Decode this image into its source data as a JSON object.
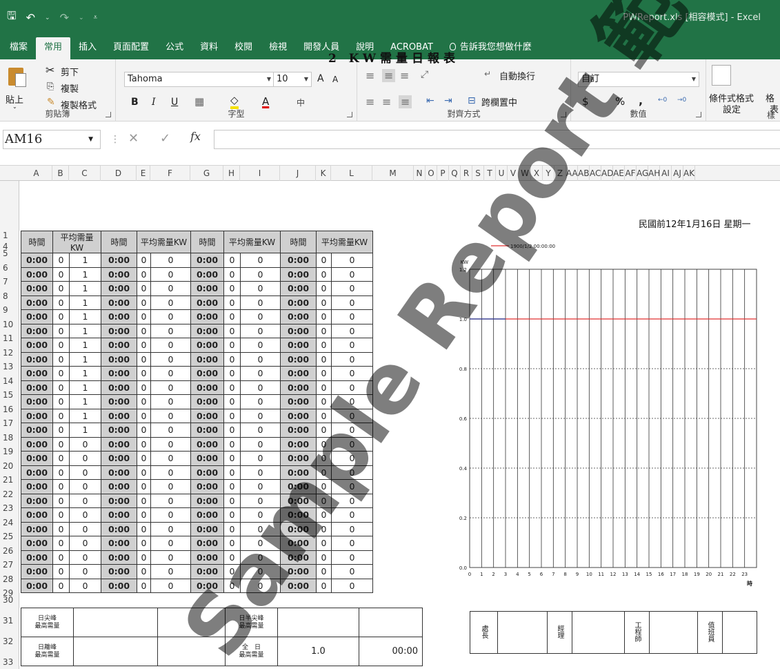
{
  "window": {
    "title": "PWReport.xls  [相容模式]  -  Excel"
  },
  "ribbon": {
    "tabs": [
      "檔案",
      "常用",
      "插入",
      "頁面配置",
      "公式",
      "資料",
      "校閱",
      "檢視",
      "開發人員",
      "說明",
      "ACROBAT"
    ],
    "active_tab": "常用",
    "tell_me": "告訴我您想做什麼",
    "clipboard": {
      "paste": "貼上",
      "cut": "剪下",
      "copy": "複製",
      "format_painter": "複製格式",
      "label": "剪貼簿"
    },
    "font": {
      "name": "Tahoma",
      "size": "10",
      "grow": "A",
      "shrink": "A",
      "bold": "B",
      "italic": "I",
      "underline": "U",
      "color_letter": "A",
      "label": "字型"
    },
    "alignment": {
      "wrap_text": "自動換行",
      "merge_center": "跨欄置中",
      "label": "對齊方式"
    },
    "number": {
      "format": "自訂",
      "currency": "$",
      "percent": "%",
      "comma": ",",
      "label": "數值"
    },
    "styles": {
      "conditional": "條件式格式",
      "conditional_line2": "設定",
      "format_as": "格",
      "format_as_line2": "表",
      "label": "樣"
    }
  },
  "formula_bar": {
    "name_box": "AM16",
    "fx": "fx",
    "cancel": "✕",
    "enter": "✓",
    "value": ""
  },
  "columns": [
    "A",
    "B",
    "C",
    "D",
    "E",
    "F",
    "G",
    "H",
    "I",
    "J",
    "K",
    "L",
    "M",
    "N",
    "O",
    "P",
    "Q",
    "R",
    "S",
    "T",
    "U",
    "V",
    "W",
    "X",
    "Y",
    "Z",
    "AA",
    "AB",
    "AC",
    "AD",
    "AE",
    "AF",
    "AG",
    "AH",
    "AI",
    "AJ",
    "AK"
  ],
  "rows": [
    "1",
    "4",
    "5",
    "6",
    "7",
    "8",
    "9",
    "10",
    "11",
    "12",
    "13",
    "14",
    "15",
    "16",
    "17",
    "18",
    "19",
    "20",
    "21",
    "22",
    "23",
    "24",
    "25",
    "26",
    "27",
    "28",
    "29",
    "30",
    "31",
    "32",
    "33"
  ],
  "report": {
    "title": "2 KW需量日報表",
    "date": "民國前12年1月16日 星期一",
    "headers": [
      "時間",
      "平均需量KW",
      "時間",
      "平均需量KW",
      "時間",
      "平均需量KW",
      "時間",
      "平均需量KW"
    ],
    "rows": [
      [
        "0:00",
        "0",
        "1",
        "0:00",
        "0",
        "0",
        "0:00",
        "0",
        "0",
        "0:00",
        "0",
        "0"
      ],
      [
        "0:00",
        "0",
        "1",
        "0:00",
        "0",
        "0",
        "0:00",
        "0",
        "0",
        "0:00",
        "0",
        "0"
      ],
      [
        "0:00",
        "0",
        "1",
        "0:00",
        "0",
        "0",
        "0:00",
        "0",
        "0",
        "0:00",
        "0",
        "0"
      ],
      [
        "0:00",
        "0",
        "1",
        "0:00",
        "0",
        "0",
        "0:00",
        "0",
        "0",
        "0:00",
        "0",
        "0"
      ],
      [
        "0:00",
        "0",
        "1",
        "0:00",
        "0",
        "0",
        "0:00",
        "0",
        "0",
        "0:00",
        "0",
        "0"
      ],
      [
        "0:00",
        "0",
        "1",
        "0:00",
        "0",
        "0",
        "0:00",
        "0",
        "0",
        "0:00",
        "0",
        "0"
      ],
      [
        "0:00",
        "0",
        "1",
        "0:00",
        "0",
        "0",
        "0:00",
        "0",
        "0",
        "0:00",
        "0",
        "0"
      ],
      [
        "0:00",
        "0",
        "1",
        "0:00",
        "0",
        "0",
        "0:00",
        "0",
        "0",
        "0:00",
        "0",
        "0"
      ],
      [
        "0:00",
        "0",
        "1",
        "0:00",
        "0",
        "0",
        "0:00",
        "0",
        "0",
        "0:00",
        "0",
        "0"
      ],
      [
        "0:00",
        "0",
        "1",
        "0:00",
        "0",
        "0",
        "0:00",
        "0",
        "0",
        "0:00",
        "0",
        "0"
      ],
      [
        "0:00",
        "0",
        "1",
        "0:00",
        "0",
        "0",
        "0:00",
        "0",
        "0",
        "0:00",
        "0",
        "0"
      ],
      [
        "0:00",
        "0",
        "1",
        "0:00",
        "0",
        "0",
        "0:00",
        "0",
        "0",
        "0:00",
        "0",
        "0"
      ],
      [
        "0:00",
        "0",
        "1",
        "0:00",
        "0",
        "0",
        "0:00",
        "0",
        "0",
        "0:00",
        "0",
        "0"
      ],
      [
        "0:00",
        "0",
        "0",
        "0:00",
        "0",
        "0",
        "0:00",
        "0",
        "0",
        "0:00",
        "0",
        "0"
      ],
      [
        "0:00",
        "0",
        "0",
        "0:00",
        "0",
        "0",
        "0:00",
        "0",
        "0",
        "0:00",
        "0",
        "0"
      ],
      [
        "0:00",
        "0",
        "0",
        "0:00",
        "0",
        "0",
        "0:00",
        "0",
        "0",
        "0:00",
        "0",
        "0"
      ],
      [
        "0:00",
        "0",
        "0",
        "0:00",
        "0",
        "0",
        "0:00",
        "0",
        "0",
        "0:00",
        "0",
        "0"
      ],
      [
        "0:00",
        "0",
        "0",
        "0:00",
        "0",
        "0",
        "0:00",
        "0",
        "0",
        "0:00",
        "0",
        "0"
      ],
      [
        "0:00",
        "0",
        "0",
        "0:00",
        "0",
        "0",
        "0:00",
        "0",
        "0",
        "0:00",
        "0",
        "0"
      ],
      [
        "0:00",
        "0",
        "0",
        "0:00",
        "0",
        "0",
        "0:00",
        "0",
        "0",
        "0:00",
        "0",
        "0"
      ],
      [
        "0:00",
        "0",
        "0",
        "0:00",
        "0",
        "0",
        "0:00",
        "0",
        "0",
        "0:00",
        "0",
        "0"
      ],
      [
        "0:00",
        "0",
        "0",
        "0:00",
        "0",
        "0",
        "0:00",
        "0",
        "0",
        "0:00",
        "0",
        "0"
      ],
      [
        "0:00",
        "0",
        "0",
        "0:00",
        "0",
        "0",
        "0:00",
        "0",
        "0",
        "0:00",
        "0",
        "0"
      ],
      [
        "0:00",
        "0",
        "0",
        "0:00",
        "0",
        "0",
        "0:00",
        "0",
        "0",
        "0:00",
        "0",
        "0"
      ]
    ],
    "summary": {
      "day_peak_l1": "日尖峰",
      "day_peak_l2": "最高需量",
      "day_half_peak_l1": "日半尖峰",
      "day_half_peak_l2": "最高需量",
      "day_offpeak_l1": "日離峰",
      "day_offpeak_l2": "最高需量",
      "full_day_l1": "全　日",
      "full_day_l2": "最高需量",
      "full_day_value": "1.0",
      "full_day_time": "00:00"
    },
    "signoff": {
      "chief": "處長",
      "manager": "經理",
      "engineer": "工程師",
      "operator": "值班員"
    }
  },
  "chart_data": {
    "type": "line",
    "ylabel": "KW",
    "xlabel": "時",
    "ylim": [
      0,
      1.2
    ],
    "yticks": [
      "0.0",
      "0.2",
      "0.4",
      "0.6",
      "0.8",
      "1.0",
      "1.2"
    ],
    "xticks": [
      "0",
      "1",
      "2",
      "3",
      "4",
      "5",
      "6",
      "7",
      "8",
      "9",
      "10",
      "11",
      "12",
      "13",
      "14",
      "15",
      "16",
      "17",
      "18",
      "19",
      "20",
      "21",
      "22",
      "23"
    ],
    "xlim": [
      0,
      24
    ],
    "grid": true,
    "legend_position": "top-left",
    "series": [
      {
        "name": "1900/1/2 00:00:00",
        "color": "#e03030",
        "x": [
          0,
          24
        ],
        "values": [
          1.0,
          1.0
        ]
      },
      {
        "color": "#1f3f9f",
        "x": [
          0,
          3
        ],
        "values": [
          1.0,
          1.0
        ]
      }
    ]
  },
  "watermark": {
    "text": "Sample Report 範本",
    "color": "#000000"
  }
}
